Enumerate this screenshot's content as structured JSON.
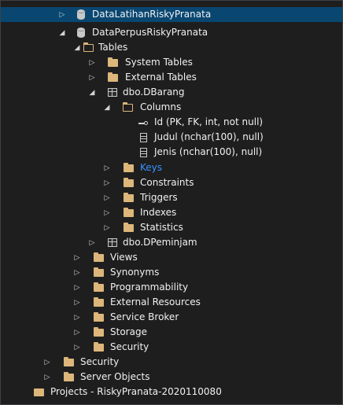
{
  "tree": {
    "db_latihan": "DataLatihanRiskyPranata",
    "db_perpus": "DataPerpusRiskyPranata",
    "tables": "Tables",
    "system_tables": "System Tables",
    "external_tables": "External Tables",
    "dbarang": "dbo.DBarang",
    "columns": "Columns",
    "col_id": "Id (PK, FK, int, not null)",
    "col_judul": "Judul (nchar(100), null)",
    "col_jenis": "Jenis (nchar(100), null)",
    "keys": "Keys",
    "constraints": "Constraints",
    "triggers": "Triggers",
    "indexes": "Indexes",
    "statistics": "Statistics",
    "dpeminjam": "dbo.DPeminjam",
    "views": "Views",
    "synonyms": "Synonyms",
    "programmability": "Programmability",
    "external_resources": "External Resources",
    "service_broker": "Service Broker",
    "storage": "Storage",
    "security_db": "Security",
    "security_server": "Security",
    "server_objects": "Server Objects",
    "projects": "Projects - RiskyPranata-2020110080"
  },
  "colors": {
    "background": "#1e1e1e",
    "selected_row": "#094771",
    "folder": "#dcb67a",
    "text": "#f1f1f1",
    "highlight_text": "#3794ff"
  }
}
